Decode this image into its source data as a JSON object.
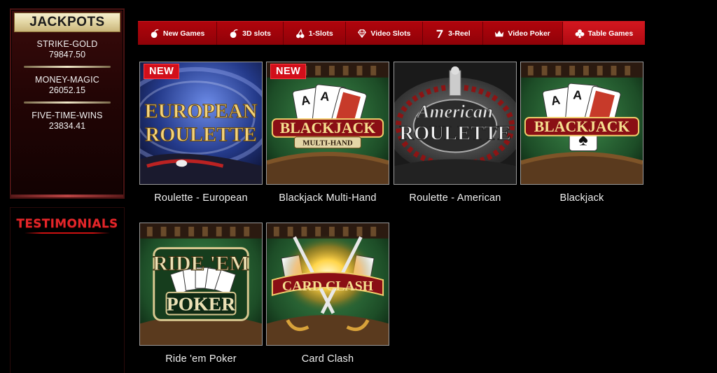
{
  "sidebar": {
    "jackpots": {
      "title": "JACKPOTS",
      "entries": [
        {
          "name": "STRIKE-GOLD",
          "amount": "79847.50"
        },
        {
          "name": "MONEY-MAGIC",
          "amount": "26052.15"
        },
        {
          "name": "FIVE-TIME-WINS",
          "amount": "23834.41"
        }
      ]
    },
    "testimonials": {
      "title": "TESTIMONIALS"
    }
  },
  "nav": {
    "items": [
      {
        "label": "New Games",
        "icon": "cherry-icon"
      },
      {
        "label": "3D slots",
        "icon": "cherry-icon"
      },
      {
        "label": "1-Slots",
        "icon": "cherries-icon"
      },
      {
        "label": "Video Slots",
        "icon": "diamond-icon"
      },
      {
        "label": "3-Reel",
        "icon": "seven-icon"
      },
      {
        "label": "Video Poker",
        "icon": "crown-icon"
      },
      {
        "label": "Table Games",
        "icon": "club-icon",
        "active": true
      }
    ]
  },
  "games": [
    {
      "title": "Roulette - European",
      "badge": "NEW",
      "art_text_1": "EUROPEAN",
      "art_text_2": "ROULETTE"
    },
    {
      "title": "Blackjack Multi-Hand",
      "badge": "NEW",
      "art_text_1": "BLACKJACK",
      "art_text_2": "MULTI-HAND"
    },
    {
      "title": "Roulette - American",
      "art_text_1": "American",
      "art_text_2": "ROULETTE"
    },
    {
      "title": "Blackjack",
      "art_text_1": "BLACKJACK"
    },
    {
      "title": "Ride 'em Poker",
      "art_text_1": "RIDE 'EM",
      "art_text_2": "POKER"
    },
    {
      "title": "Card Clash",
      "art_text_1": "CARD CLASH"
    }
  ],
  "colors": {
    "nav_bg": "#a6030a",
    "badge_red": "#d20f1a",
    "testimonials_red": "#e3262a",
    "gold_header": "#e2d5a3"
  }
}
